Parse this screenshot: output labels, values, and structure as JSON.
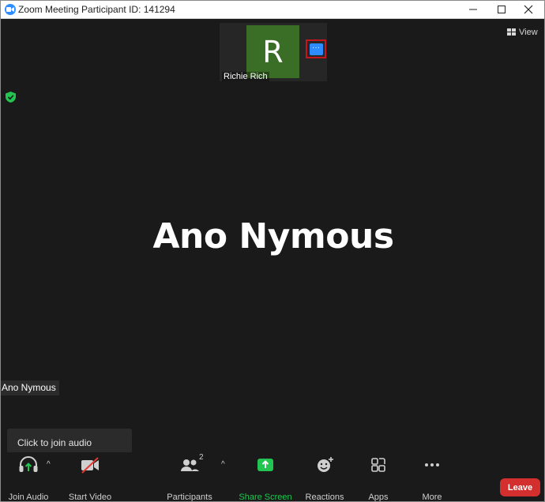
{
  "window": {
    "title": "Zoom Meeting Participant ID: 141294",
    "minimize_icon": "minimize-icon",
    "maximize_icon": "maximize-icon",
    "close_icon": "close-icon"
  },
  "top_bar": {
    "view_label": "View"
  },
  "thumbnail": {
    "initial": "R",
    "name": "Richie Rich",
    "avatar_color": "#3a6e26",
    "more_label": "···",
    "highlight_color": "#c4161c"
  },
  "main": {
    "speaker_name": "Ano Nymous",
    "name_tag": "Ano Nymous"
  },
  "tooltip": {
    "text": "Click to join audio"
  },
  "toolbar": {
    "join_audio": "Join Audio",
    "start_video": "Start Video",
    "participants": "Participants",
    "participants_count": "2",
    "share_screen": "Share Screen",
    "reactions": "Reactions",
    "apps": "Apps",
    "more": "More",
    "leave": "Leave",
    "share_color": "#2ecc40",
    "leave_color": "#d32f2f"
  }
}
